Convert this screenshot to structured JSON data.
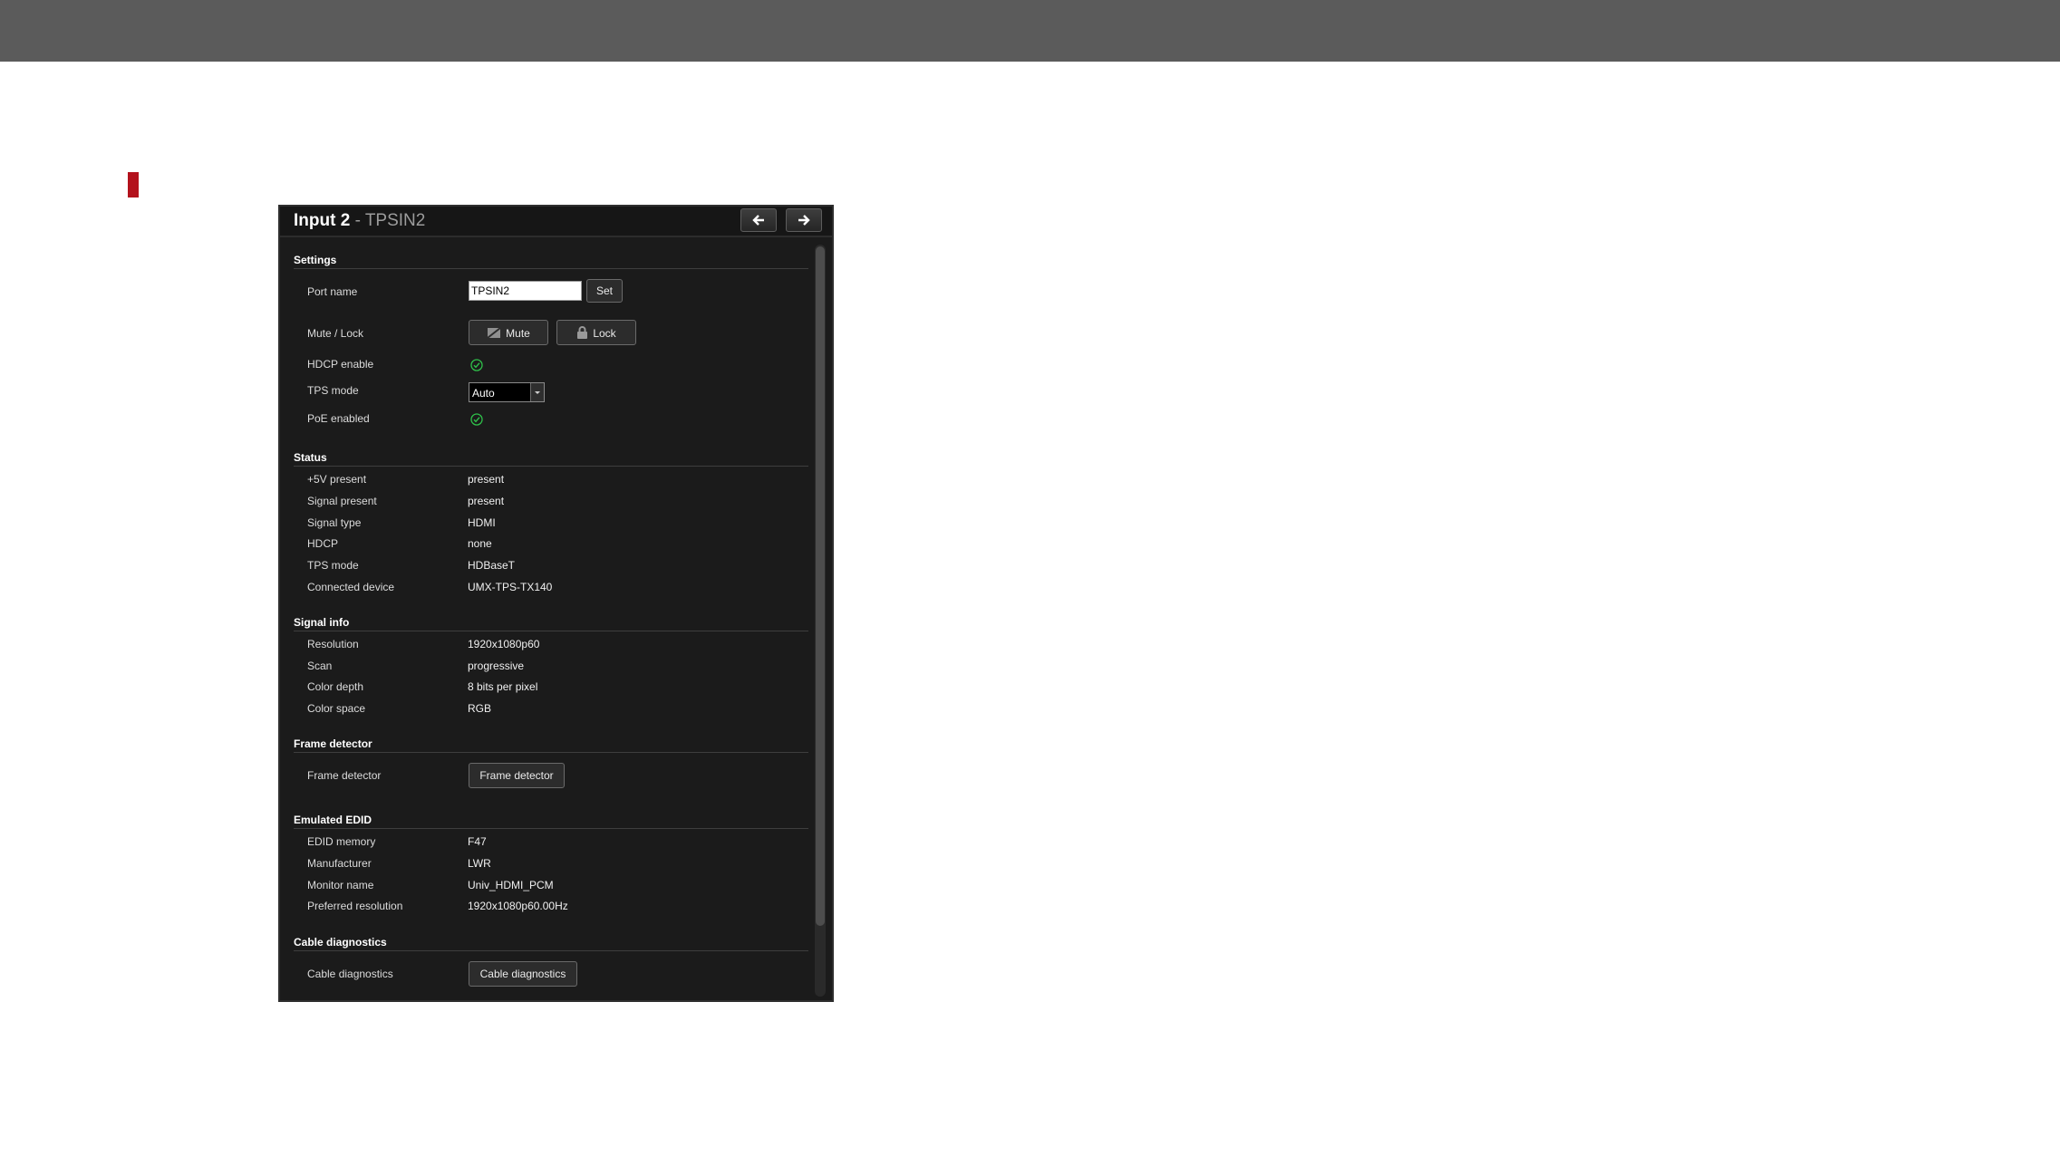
{
  "panel": {
    "title": "Input 2",
    "separator": "-",
    "subtitle": "TPSIN2"
  },
  "icons": {
    "prev": "arrow-left-icon",
    "next": "arrow-right-icon",
    "mute": "mute-icon",
    "lock": "lock-icon",
    "check": "check-circle-icon"
  },
  "colors": {
    "top_bar": "#5b5b5b",
    "marker": "#b3121c",
    "panel_bg": "#1b1b1b",
    "check_green": "#2fc04a"
  },
  "settings": {
    "title": "Settings",
    "port_name": {
      "label": "Port name",
      "value": "TPSIN2",
      "button": "Set"
    },
    "mute_lock": {
      "label": "Mute / Lock",
      "mute_button": "Mute",
      "lock_button": "Lock"
    },
    "hdcp_enable": {
      "label": "HDCP enable",
      "checked": true
    },
    "tps_mode": {
      "label": "TPS mode",
      "value": "Auto"
    },
    "poe_enabled": {
      "label": "PoE enabled",
      "checked": true
    }
  },
  "status": {
    "title": "Status",
    "rows": [
      {
        "label": "+5V present",
        "value": "present"
      },
      {
        "label": "Signal present",
        "value": "present"
      },
      {
        "label": "Signal type",
        "value": "HDMI"
      },
      {
        "label": "HDCP",
        "value": "none"
      },
      {
        "label": "TPS mode",
        "value": "HDBaseT"
      },
      {
        "label": "Connected device",
        "value": "UMX-TPS-TX140"
      }
    ]
  },
  "signal_info": {
    "title": "Signal info",
    "rows": [
      {
        "label": "Resolution",
        "value": "1920x1080p60"
      },
      {
        "label": "Scan",
        "value": "progressive"
      },
      {
        "label": "Color depth",
        "value": "8 bits per pixel"
      },
      {
        "label": "Color space",
        "value": "RGB"
      }
    ]
  },
  "frame_detector": {
    "title": "Frame detector",
    "label": "Frame detector",
    "button": "Frame detector"
  },
  "emulated_edid": {
    "title": "Emulated EDID",
    "rows": [
      {
        "label": "EDID memory",
        "value": "F47"
      },
      {
        "label": "Manufacturer",
        "value": "LWR"
      },
      {
        "label": "Monitor name",
        "value": "Univ_HDMI_PCM"
      },
      {
        "label": "Preferred resolution",
        "value": "1920x1080p60.00Hz"
      }
    ]
  },
  "cable_diagnostics": {
    "title": "Cable diagnostics",
    "label": "Cable diagnostics",
    "button": "Cable diagnostics"
  }
}
